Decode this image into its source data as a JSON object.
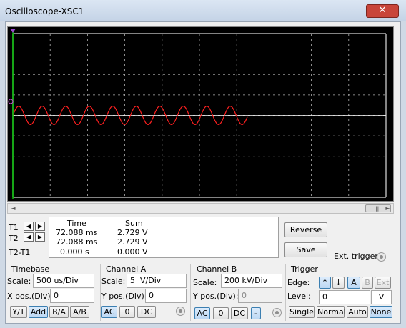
{
  "window": {
    "title": "Oscilloscope-XSC1",
    "close_glyph": "✕"
  },
  "screen": {
    "background": "#000000",
    "grid_color": "#b0b0b0",
    "trace_color": "#ff2020",
    "cursor_color": "#00c000",
    "divisions": {
      "horizontal": 10,
      "vertical": 8
    },
    "signal": {
      "cycles_visible": 10,
      "amplitude_div": 0.45,
      "ends_at_div": 6.3
    }
  },
  "scrollbar": {
    "thumb_glyph": "|||",
    "left_glyph": "◄",
    "right_glyph": "►"
  },
  "cursors": {
    "t1_label": "T1",
    "t2_label": "T2",
    "diff_label": "T2-T1",
    "left_glyph": "◀",
    "right_glyph": "▶"
  },
  "readout": {
    "headers": {
      "time": "Time",
      "sum": "Sum"
    },
    "rows": [
      {
        "time": "72.088 ms",
        "sum": "2.729 V"
      },
      {
        "time": "72.088 ms",
        "sum": "2.729 V"
      },
      {
        "time": "0.000 s",
        "sum": "0.000 V"
      }
    ]
  },
  "buttons": {
    "reverse": "Reverse",
    "save": "Save",
    "ext_trigger": "Ext. trigger"
  },
  "timebase": {
    "title": "Timebase",
    "scale_label": "Scale:",
    "scale_value": "500 us/Div",
    "xpos_label": "X pos.(Div):",
    "xpos_value": "0",
    "modes": [
      "Y/T",
      "Add",
      "B/A",
      "A/B"
    ]
  },
  "channel_a": {
    "title": "Channel A",
    "scale_label": "Scale:",
    "scale_value": "5  V/Div",
    "ypos_label": "Y pos.(Div):",
    "ypos_value": "0",
    "coupling": [
      "AC",
      "0",
      "DC"
    ]
  },
  "channel_b": {
    "title": "Channel B",
    "scale_label": "Scale:",
    "scale_value": "200 kV/Div",
    "ypos_label": "Y pos.(Div):",
    "ypos_value": "0",
    "coupling": [
      "AC",
      "0",
      "DC",
      "-"
    ]
  },
  "trigger": {
    "title": "Trigger",
    "edge_label": "Edge:",
    "level_label": "Level:",
    "level_value": "0",
    "level_unit": "V",
    "edge_buttons": [
      "↑",
      "↓",
      "A",
      "B",
      "Ext"
    ],
    "modes": [
      "Single",
      "Normal",
      "Auto",
      "None"
    ]
  }
}
